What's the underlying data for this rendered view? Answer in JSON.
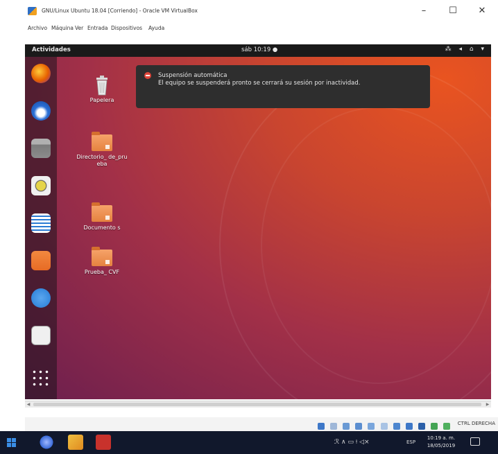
{
  "vbox": {
    "title": "GNU/Linux Ubuntu 18.04 [Corriendo] - Oracle VM VirtualBox",
    "window_buttons": {
      "minimize": "–",
      "maximize": "☐",
      "close": "✕"
    },
    "menu": [
      "Archivo",
      "Máquina",
      "Ver",
      "Entrada",
      "Dispositivos",
      "Ayuda"
    ],
    "host_key": "CTRL DERECHA"
  },
  "ubuntu": {
    "activities": "Actividades",
    "clock": "sáb 10:19 ●",
    "tray_icons": "⁂ ◂ ⌂ ▾",
    "dock": [
      {
        "name": "firefox-icon",
        "color": "#e66000"
      },
      {
        "name": "thunderbird-icon",
        "color": "#2a6fd6"
      },
      {
        "name": "files-icon",
        "color": "#8c8c8c"
      },
      {
        "name": "rhythmbox-icon",
        "color": "#e5d44a"
      },
      {
        "name": "libreoffice-writer-icon",
        "color": "#2a7bd4"
      },
      {
        "name": "software-center-icon",
        "color": "#e76b25"
      },
      {
        "name": "help-icon",
        "color": "#3b8de0"
      },
      {
        "name": "amazon-icon",
        "color": "#f0f0f0"
      },
      {
        "name": "show-applications-icon",
        "color": "#ffffff"
      }
    ],
    "desktop": [
      {
        "name": "trash",
        "label": "Papelera"
      },
      {
        "name": "folder-directorio-de-prueba",
        "label": "Directorio_ de_prueba"
      },
      {
        "name": "folder-documentos",
        "label": "Documento s"
      },
      {
        "name": "folder-prueba-cvf",
        "label": "Prueba_ CVF"
      }
    ],
    "notification": {
      "title": "Suspensión automática",
      "body": "El equipo se suspenderá pronto se cerrará su sesión por inactividad."
    }
  },
  "taskbar": {
    "tray": "ℛ ∧ ▭ ⟊ ◁×",
    "lang": "ESP",
    "time": "10:19 a. m.",
    "date": "18/05/2019"
  },
  "colors": {
    "ubuntu_orange": "#e95420",
    "ubuntu_aubergine": "#6c1f4e",
    "taskbar_bg": "#11182c"
  }
}
